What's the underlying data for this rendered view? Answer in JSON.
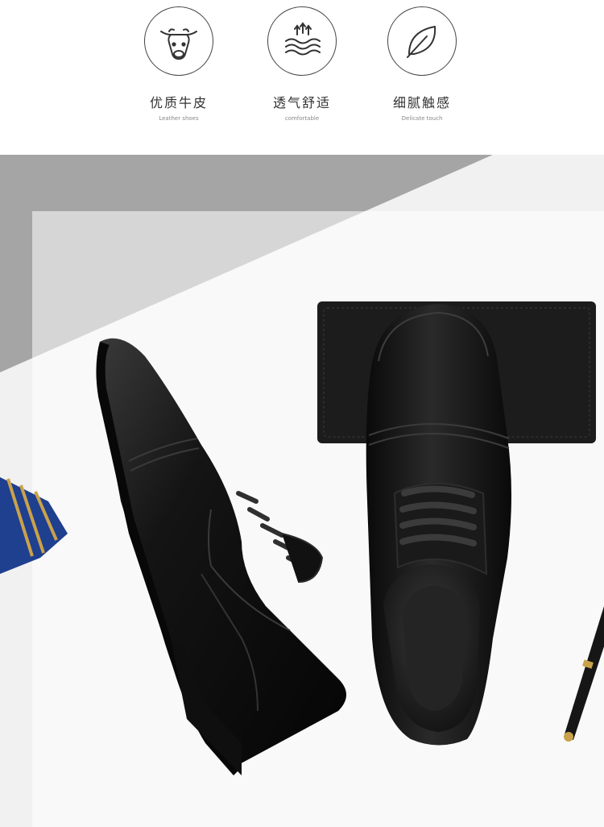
{
  "features": [
    {
      "icon": "cow-icon",
      "title": "优质牛皮",
      "subtitle": "Leather shoes"
    },
    {
      "icon": "breathable-waves-icon",
      "title": "透气舒适",
      "subtitle": "comfortable"
    },
    {
      "icon": "leaf-icon",
      "title": "细腻触感",
      "subtitle": "Delicate touch"
    }
  ],
  "colors": {
    "shoe": "#141414",
    "wallet": "#1c1c1c",
    "tie_blue": "#1f3f8f",
    "tie_stripe": "#c9a24a",
    "background_gray": "#a7a7a7",
    "background_light": "#f1f1f1"
  }
}
